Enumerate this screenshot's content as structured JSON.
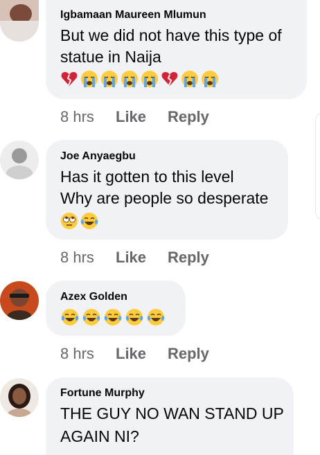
{
  "comments": [
    {
      "author": "Igbamaan Maureen Mlumun",
      "lines": [
        "But we did not have this type of",
        "statue in Naija"
      ],
      "emojis": [
        "broken-heart",
        "crying",
        "crying",
        "crying",
        "crying",
        "broken-heart",
        "crying",
        "crying"
      ],
      "time": "8 hrs",
      "like": "Like",
      "reply": "Reply"
    },
    {
      "author": "Joe Anyaegbu",
      "lines": [
        "Has it gotten to this level",
        "Why are people so desperate"
      ],
      "emojis": [
        "rolling-eyes",
        "tears-of-joy"
      ],
      "time": "8 hrs",
      "like": "Like",
      "reply": "Reply"
    },
    {
      "author": "Azex Golden",
      "lines": [],
      "emojis": [
        "tears-of-joy",
        "tears-of-joy",
        "tears-of-joy",
        "tears-of-joy",
        "tears-of-joy"
      ],
      "time": "8 hrs",
      "like": "Like",
      "reply": "Reply"
    },
    {
      "author": "Fortune Murphy",
      "lines": [
        "THE GUY NO WAN STAND UP",
        "AGAIN NI?"
      ],
      "emojis": [],
      "time": "",
      "like": "",
      "reply": ""
    }
  ],
  "colors": {
    "bubble": "#f0f2f5",
    "text": "#050505",
    "meta": "#65676b",
    "emoji_yellow": "#ffcc3d",
    "emoji_blue": "#5aa7f0",
    "heart_red": "#d42236"
  }
}
